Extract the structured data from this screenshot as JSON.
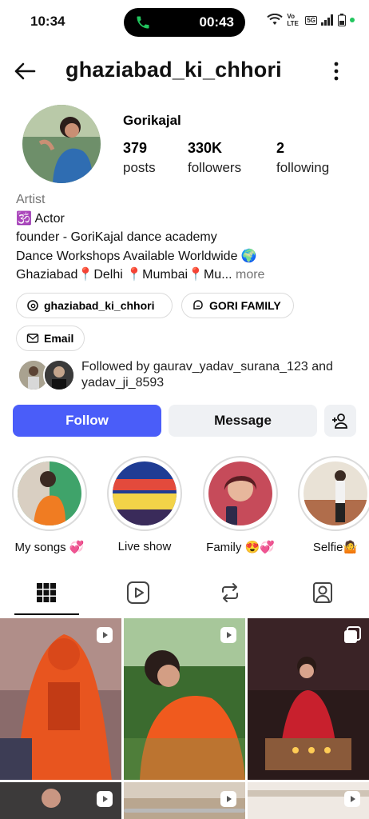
{
  "status_bar": {
    "time": "10:34",
    "call_duration": "00:43",
    "network_label": "5G",
    "volte_label": "Vo LTE"
  },
  "header": {
    "username": "ghaziabad_ki_chhori"
  },
  "profile": {
    "display_name": "Gorikajal",
    "stats": [
      {
        "value": "379",
        "label": "posts"
      },
      {
        "value": "330K",
        "label": "followers"
      },
      {
        "value": "2",
        "label": "following"
      }
    ],
    "bio": {
      "category": "Artist",
      "line1": "🕉️ Actor",
      "line2": "founder - GoriKajal dance academy",
      "line3": "Dance Workshops Available Worldwide 🌍",
      "line4": "Ghaziabad📍Delhi 📍Mumbai📍Mu...",
      "more": "more"
    },
    "chips": [
      {
        "label": "ghaziabad_ki_chhori",
        "icon": "threads-icon"
      },
      {
        "label": "GORI FAMILY",
        "icon": "broadcast-channel-icon"
      },
      {
        "label": "Email",
        "icon": "mail-icon"
      }
    ],
    "followed_by": "Followed by gaurav_yadav_surana_123 and yadav_ji_8593"
  },
  "actions": {
    "follow": "Follow",
    "message": "Message"
  },
  "highlights": [
    {
      "label": "My songs 💞"
    },
    {
      "label": "Live show"
    },
    {
      "label": "Family 😍💞"
    },
    {
      "label": "Selfie🤷"
    }
  ],
  "tabs": [
    "grid-icon",
    "reels-icon",
    "reposts-icon",
    "tagged-icon"
  ],
  "colors": {
    "accent": "#4a5df9",
    "secondary_button": "#eff1f4",
    "muted_text": "#737373"
  }
}
